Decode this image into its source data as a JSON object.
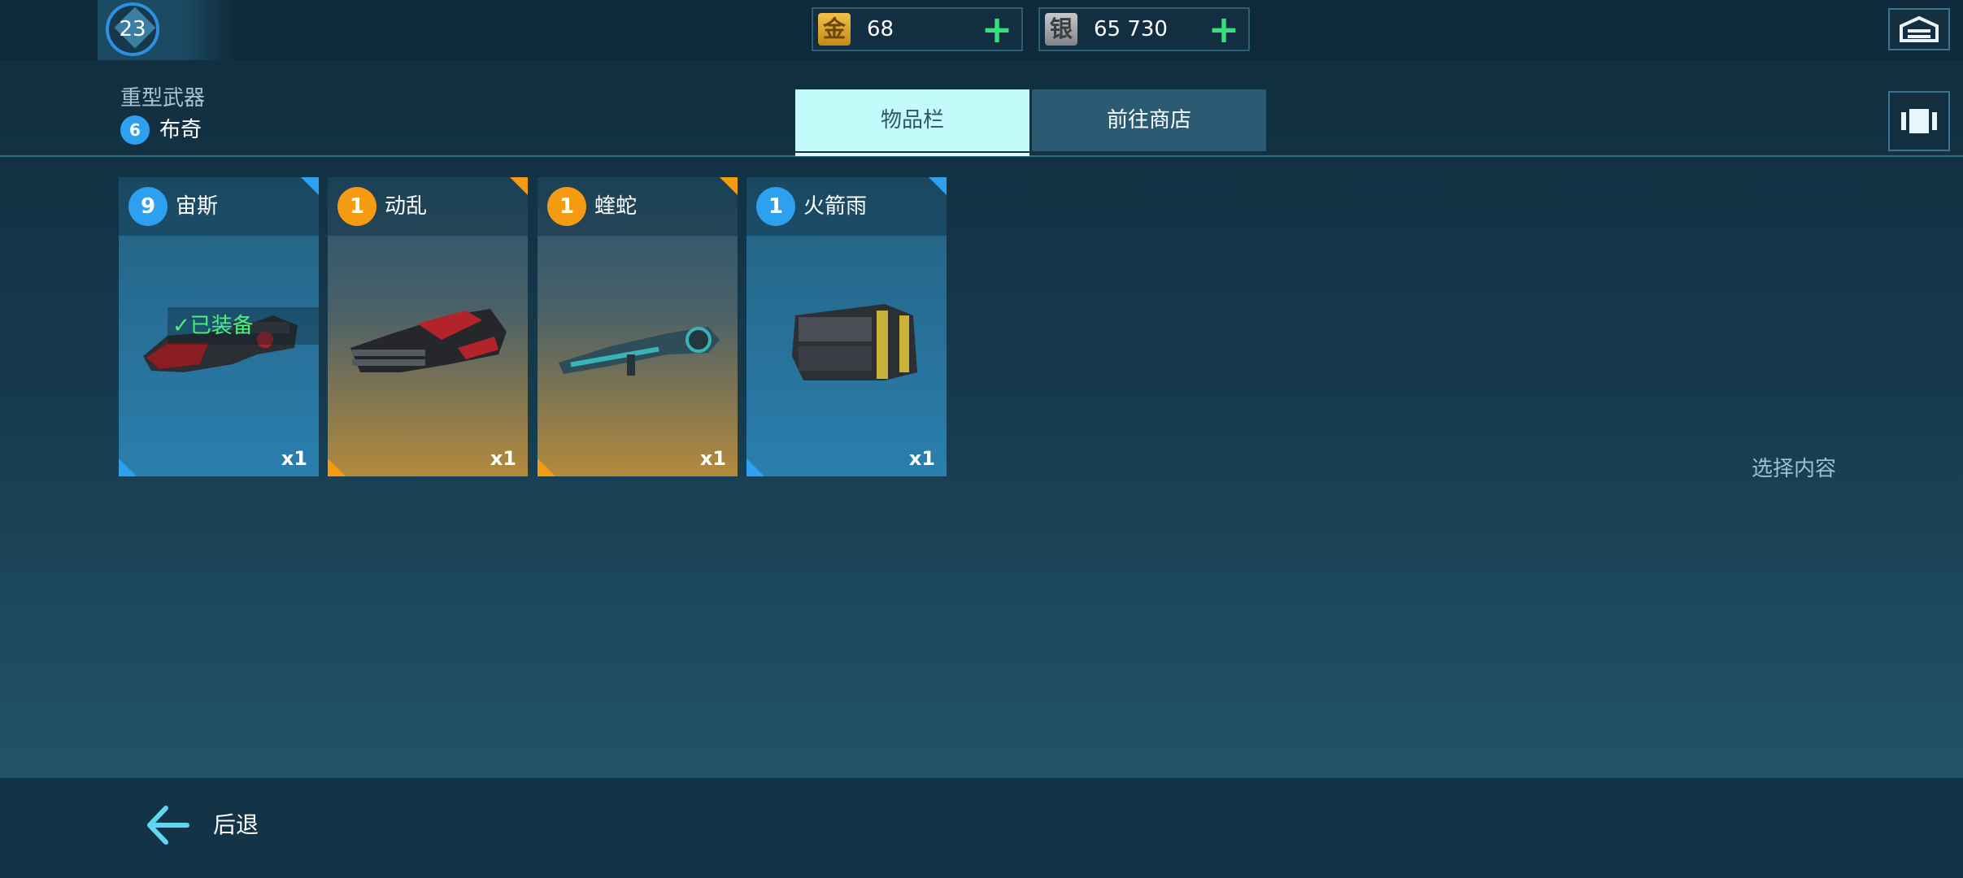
{
  "player": {
    "level": "23"
  },
  "currencies": {
    "gold": {
      "icon_char": "金",
      "value": "68",
      "plus": "+"
    },
    "silver": {
      "icon_char": "银",
      "value": "65 730",
      "plus": "+"
    }
  },
  "header": {
    "category": "重型武器",
    "robot_level": "6",
    "robot_name": "布奇"
  },
  "tabs": [
    {
      "label": "物品栏",
      "active": true
    },
    {
      "label": "前往商店",
      "active": false
    }
  ],
  "cards": [
    {
      "level": "9",
      "name": "宙斯",
      "qty": "x1",
      "rarity": "blue",
      "equipped_label": "已装备"
    },
    {
      "level": "1",
      "name": "动乱",
      "qty": "x1",
      "rarity": "gold"
    },
    {
      "level": "1",
      "name": "蝰蛇",
      "qty": "x1",
      "rarity": "gold"
    },
    {
      "level": "1",
      "name": "火箭雨",
      "qty": "x1",
      "rarity": "blue"
    }
  ],
  "hint": "选择内容",
  "footer": {
    "back_label": "后退"
  },
  "colors": {
    "accent_green": "#35e07a",
    "tab_active": "#c2fbfa",
    "rarity_blue": "#2ea0f0",
    "rarity_orange": "#f59b12"
  }
}
